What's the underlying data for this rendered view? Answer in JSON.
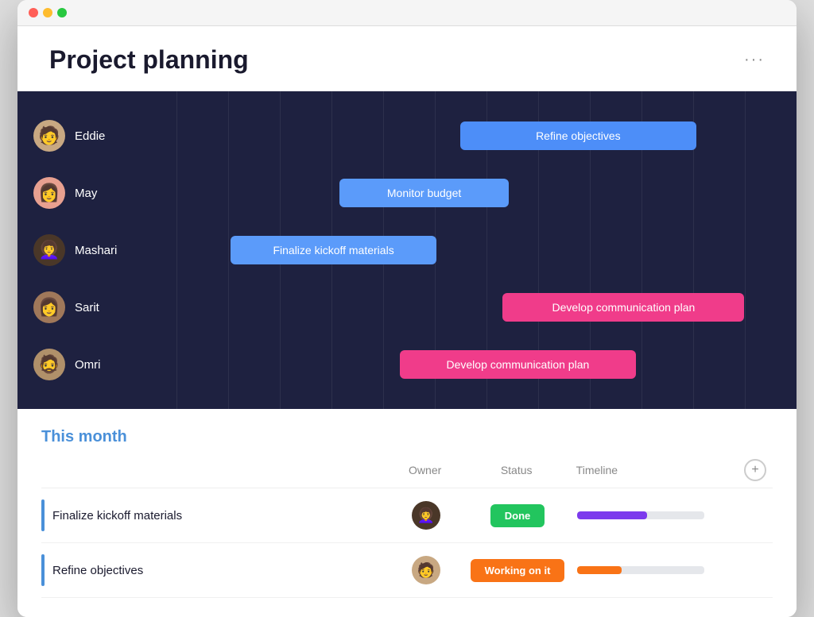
{
  "window": {
    "title": "Project planning",
    "more_label": "···"
  },
  "header": {
    "title": "Project planning",
    "more_label": "···"
  },
  "gantt": {
    "rows": [
      {
        "id": "eddie",
        "name": "Eddie",
        "avatar_emoji": "🧑",
        "bar": {
          "label": "Refine objectives",
          "color": "bar-blue",
          "left": "47%",
          "width": "39%"
        }
      },
      {
        "id": "may",
        "name": "May",
        "avatar_emoji": "👩",
        "bar": {
          "label": "Monitor budget",
          "color": "bar-blue-light",
          "left": "27%",
          "width": "28%"
        }
      },
      {
        "id": "mashari",
        "name": "Mashari",
        "avatar_emoji": "👩‍🦱",
        "bar": {
          "label": "Finalize kickoff materials",
          "color": "bar-blue-light",
          "left": "9%",
          "width": "33%"
        }
      },
      {
        "id": "sarit",
        "name": "Sarit",
        "avatar_emoji": "👩",
        "bar": {
          "label": "Develop communication plan",
          "color": "bar-pink",
          "left": "54%",
          "width": "40%"
        }
      },
      {
        "id": "omri",
        "name": "Omri",
        "avatar_emoji": "🧔",
        "bar": {
          "label": "Develop communication plan",
          "color": "bar-pink",
          "left": "37%",
          "width": "39%"
        }
      }
    ]
  },
  "table": {
    "section_title": "This month",
    "columns": {
      "owner": "Owner",
      "status": "Status",
      "timeline": "Timeline"
    },
    "rows": [
      {
        "id": "row1",
        "task": "Finalize kickoff materials",
        "owner_emoji": "👩‍🦱",
        "owner_color": "#4a3728",
        "status_label": "Done",
        "status_class": "status-done",
        "timeline_pct": 55,
        "timeline_class": "fill-purple"
      },
      {
        "id": "row2",
        "task": "Refine objectives",
        "owner_emoji": "🧑",
        "owner_color": "#c8a882",
        "status_label": "Working on it",
        "status_class": "status-working",
        "timeline_pct": 35,
        "timeline_class": "fill-orange"
      }
    ]
  }
}
